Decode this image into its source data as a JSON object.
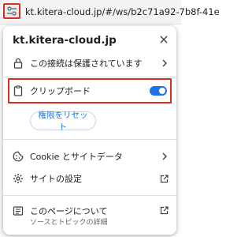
{
  "addressbar": {
    "url": "kt.kitera-cloud.jp/#/ws/b2c71a92-7b8f-41e"
  },
  "popup": {
    "site_title": "kt.kitera-cloud.jp",
    "connection": {
      "label": "この接続は保護されています"
    },
    "clipboard": {
      "label": "クリップボード",
      "enabled": true
    },
    "reset_button": {
      "label": "権限をリセット"
    },
    "cookie": {
      "label": "Cookie とサイトデータ"
    },
    "site_settings": {
      "label": "サイトの設定"
    },
    "about": {
      "label": "このページについて",
      "sublabel": "ソースとトピックの詳細"
    }
  },
  "colors": {
    "accent": "#1a73e8",
    "highlight_border": "#d93025",
    "text": "#202124",
    "secondary_text": "#5f6368"
  },
  "icons": [
    "site-settings-icon",
    "close-icon",
    "lock-icon",
    "chevron-right-icon",
    "clipboard-icon",
    "cookie-icon",
    "gear-icon",
    "open-external-icon",
    "about-page-icon"
  ]
}
